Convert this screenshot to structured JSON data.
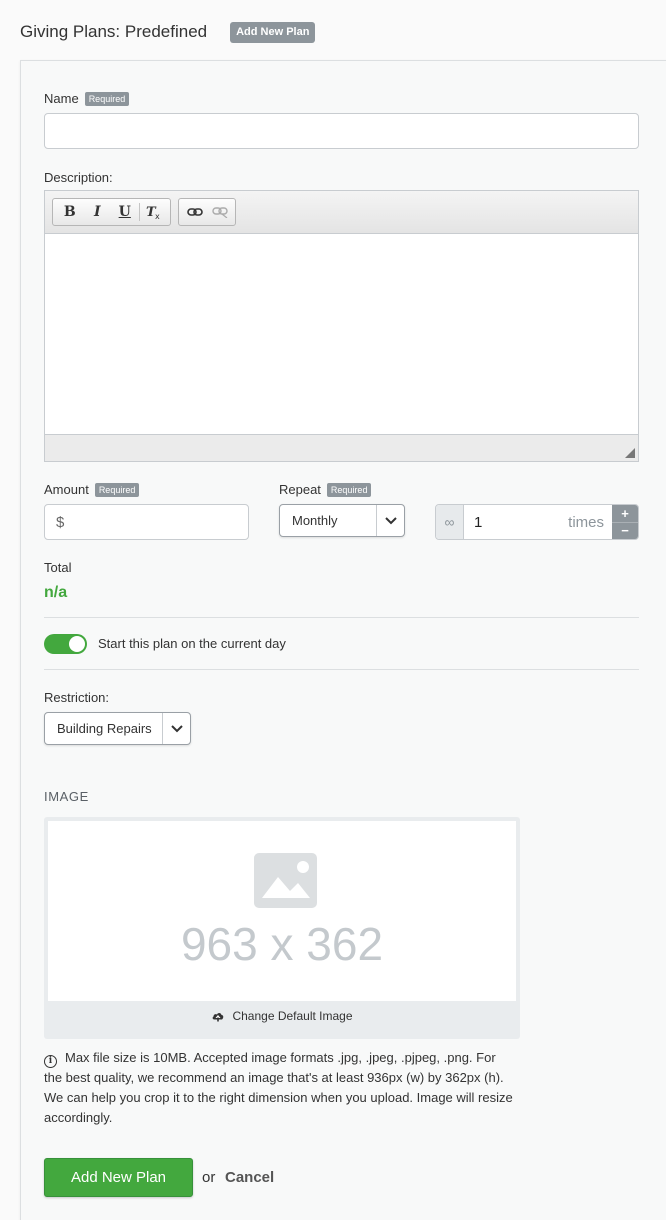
{
  "header": {
    "title": "Giving Plans: Predefined",
    "add_button": "Add New Plan"
  },
  "form": {
    "required_badge": "Required",
    "name": {
      "label": "Name",
      "value": ""
    },
    "description": {
      "label": "Description:",
      "toolbar": [
        "bold-icon",
        "italic-icon",
        "underline-icon",
        "clear-format-icon",
        "link-icon",
        "unlink-icon"
      ]
    },
    "amount": {
      "label": "Amount",
      "prefix": "$",
      "value": ""
    },
    "repeat": {
      "label": "Repeat",
      "selected": "Monthly"
    },
    "occurrences": {
      "infinity": "∞",
      "value": "1",
      "unit": "times",
      "increment": "+",
      "decrement": "−"
    },
    "total": {
      "label": "Total",
      "value": "n/a"
    },
    "start_toggle": {
      "label": "Start this plan on the current day",
      "checked": true
    },
    "restriction": {
      "label": "Restriction:",
      "selected": "Building Repairs"
    }
  },
  "image_section": {
    "title": "IMAGE",
    "placeholder_text": "963 x 362",
    "change_label": "Change Default Image",
    "info_text": "Max file size is 10MB. Accepted image formats .jpg, .jpeg, .pjpeg, .png. For the best quality, we recommend an image that's at least 936px (w) by 362px (h). We can help you crop it to the right dimension when you upload. Image will resize accordingly."
  },
  "actions": {
    "submit_label": "Add New Plan",
    "or_text": "or",
    "cancel_label": "Cancel"
  },
  "colors": {
    "accent_green": "#43a83e",
    "badge_gray": "#8d959b"
  }
}
